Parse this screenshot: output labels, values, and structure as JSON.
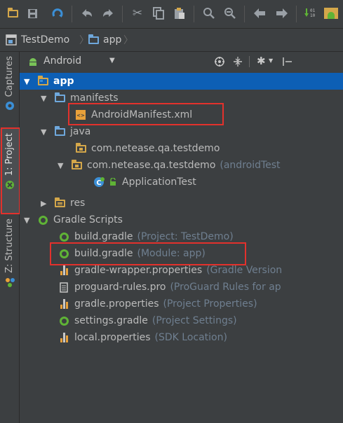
{
  "breadcrumb": {
    "project": "TestDemo",
    "module": "app"
  },
  "sidebar": {
    "captures": "Captures",
    "project": "1: Project",
    "structure": "Z: Structure"
  },
  "panel": {
    "view_selector": "Android"
  },
  "tree": {
    "app": "app",
    "manifests": "manifests",
    "android_manifest": "AndroidManifest.xml",
    "java": "java",
    "pkg_main": "com.netease.qa.testdemo",
    "pkg_test": "com.netease.qa.testdemo",
    "pkg_test_hint": "(androidTest",
    "application_test": "ApplicationTest",
    "res": "res",
    "gradle_scripts": "Gradle Scripts",
    "build_gradle_project": "build.gradle",
    "build_gradle_project_hint": "(Project: TestDemo)",
    "build_gradle_module": "build.gradle",
    "build_gradle_module_hint": "(Module: app)",
    "gradle_wrapper": "gradle-wrapper.properties",
    "gradle_wrapper_hint": "(Gradle Version",
    "proguard": "proguard-rules.pro",
    "proguard_hint": "(ProGuard Rules for ap",
    "gradle_properties": "gradle.properties",
    "gradle_properties_hint": "(Project Properties)",
    "settings_gradle": "settings.gradle",
    "settings_gradle_hint": "(Project Settings)",
    "local_properties": "local.properties",
    "local_properties_hint": "(SDK Location)"
  },
  "colors": {
    "selection": "#0d5fb5",
    "highlight_box": "#e3312c",
    "folder": "#d4a74a",
    "gradle": "#5fb336"
  }
}
